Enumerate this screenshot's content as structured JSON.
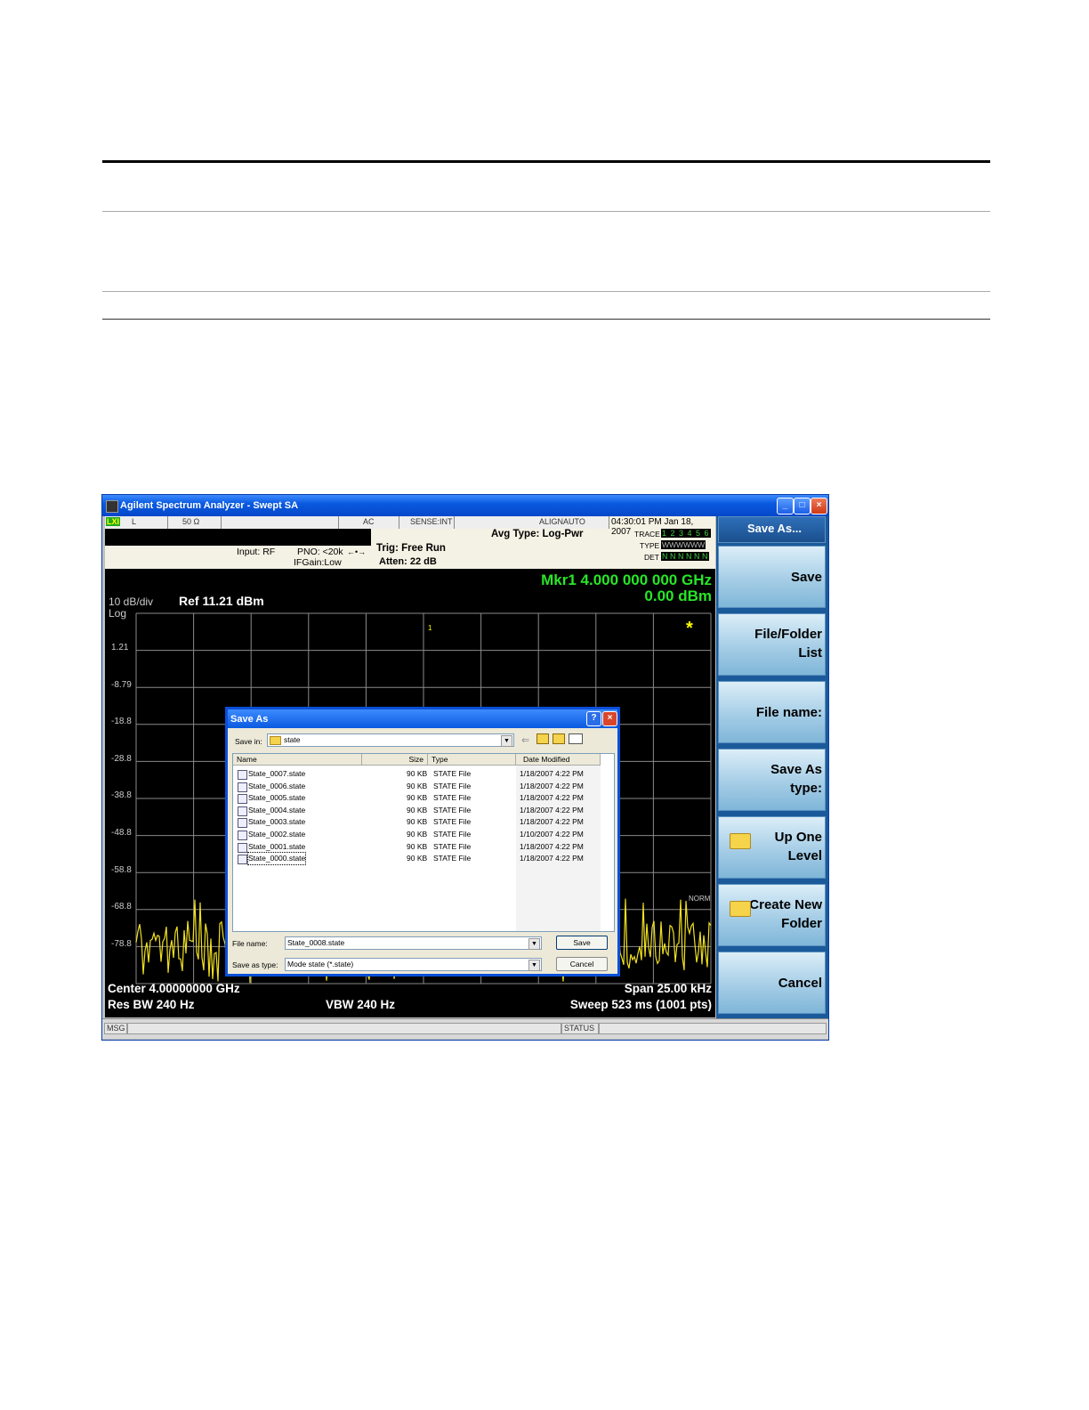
{
  "window": {
    "title": "Agilent Spectrum Analyzer - Swept SA",
    "min": "_",
    "max": "□",
    "close": "×"
  },
  "status_row": {
    "lxi": "LXI",
    "l": "L",
    "impedance": "50 Ω",
    "ac": "AC",
    "sense": "SENSE:INT",
    "align": "ALIGNAUTO",
    "datetime": "04:30:01 PM Jan 18, 2007"
  },
  "info": {
    "input": "Input: RF",
    "pno": "PNO: <20k",
    "ifgain": "IFGain:Low",
    "trig": "Trig: Free Run",
    "atten": "Atten: 22 dB",
    "avg": "Avg Type: Log-Pwr",
    "trace_label": "TRACE",
    "trace_values": "1 2 3 4 5 6",
    "type_label": "TYPE",
    "type_values": "WWWWWW",
    "det_label": "DET",
    "det_values": "N N N N N N"
  },
  "plot": {
    "scale": "10 dB/div",
    "log": "Log",
    "ref": "Ref 11.21 dBm",
    "mkr": "Mkr1 4.000 000 000 GHz",
    "mkr_val": "0.00 dBm",
    "yticks": [
      "1.21",
      "-8.79",
      "-18.8",
      "-28.8",
      "-38.8",
      "-48.8",
      "-58.8",
      "-68.8",
      "-78.8"
    ],
    "star": "*",
    "norm": "NORM",
    "marker1": "1",
    "center": "Center 4.00000000 GHz",
    "span": "Span 25.00 kHz",
    "rbw": "Res BW 240 Hz",
    "vbw": "VBW 240 Hz",
    "sweep": "Sweep  523 ms (1001 pts)"
  },
  "msgbar": {
    "msg": "MSG",
    "status": "STATUS"
  },
  "softkeys": {
    "header": "Save As...",
    "save": "Save",
    "filefolder_1": "File/Folder",
    "filefolder_2": "List",
    "filename": "File name:",
    "saveastype_1": "Save As",
    "saveastype_2": "type:",
    "upone_1": "Up One",
    "upone_2": "Level",
    "createnew_1": "Create New",
    "createnew_2": "Folder",
    "cancel": "Cancel"
  },
  "dialog": {
    "title": "Save As",
    "help": "?",
    "close": "×",
    "save_in_label": "Save in:",
    "save_in_value": "state",
    "columns": {
      "name": "Name",
      "size": "Size",
      "type": "Type",
      "date": "Date Modified"
    },
    "files": [
      {
        "name": "State_0007.state",
        "size": "90 KB",
        "type": "STATE File",
        "date": "1/18/2007 4:22 PM"
      },
      {
        "name": "State_0006.state",
        "size": "90 KB",
        "type": "STATE File",
        "date": "1/18/2007 4:22 PM"
      },
      {
        "name": "State_0005.state",
        "size": "90 KB",
        "type": "STATE File",
        "date": "1/18/2007 4:22 PM"
      },
      {
        "name": "State_0004.state",
        "size": "90 KB",
        "type": "STATE File",
        "date": "1/18/2007 4:22 PM"
      },
      {
        "name": "State_0003.state",
        "size": "90 KB",
        "type": "STATE File",
        "date": "1/18/2007 4:22 PM"
      },
      {
        "name": "State_0002.state",
        "size": "90 KB",
        "type": "STATE File",
        "date": "1/10/2007 4:22 PM"
      },
      {
        "name": "State_0001.state",
        "size": "90 KB",
        "type": "STATE File",
        "date": "1/18/2007 4:22 PM"
      },
      {
        "name": "State_0000.state",
        "size": "90 KB",
        "type": "STATE File",
        "date": "1/18/2007 4:22 PM"
      }
    ],
    "filename_label": "File name:",
    "filename_value": "State_0008.state",
    "type_label": "Save as type:",
    "type_value": "Mode state (*.state)",
    "save_btn": "Save",
    "cancel_btn": "Cancel"
  }
}
